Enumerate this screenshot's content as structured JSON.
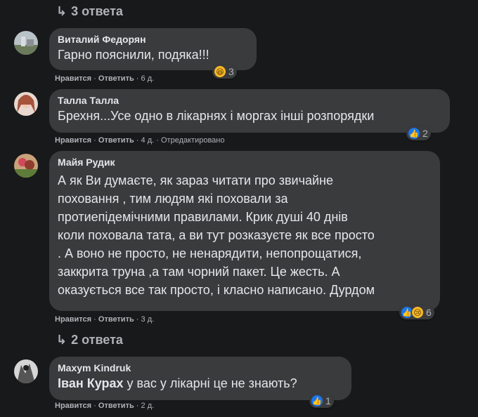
{
  "thread1_replies": {
    "label": "3 ответа"
  },
  "thread2_replies": {
    "label": "2 ответа"
  },
  "labels": {
    "like": "Нравится",
    "reply": "Ответить",
    "edited": "Отредактировано",
    "sep": "·"
  },
  "comments": [
    {
      "author": "Виталий Федорян",
      "lines": [
        "Гарно пояснили, подяка!!!"
      ],
      "time": "6 д.",
      "reaction_icons": [
        "haha-icon"
      ],
      "reaction_count": "3"
    },
    {
      "author": "Талла Талла",
      "lines": [
        "Брехня...Усе одно в лікарнях і моргах інші розпорядки"
      ],
      "time": "4 д.",
      "edited": true,
      "reaction_icons": [
        "like-icon"
      ],
      "reaction_count": "2"
    },
    {
      "author": "Майя Рудик",
      "lines": [
        "А як Ви думаєте, як зараз читати про звичайне",
        "поховання , тим людям які поховали за",
        "протиепідемічними правилами. Крик душі 40 днів",
        "коли поховала тата, а ви тут розказуєте як все просто",
        ". А воно не просто, не ненарядити, непопрощатися,",
        "заккрита труна ,а там чорний пакет. Це жесть. А",
        "оказується все так просто, і класно написано. Дурдом"
      ],
      "time": "3 д.",
      "reaction_icons": [
        "like-icon",
        "sad-icon"
      ],
      "reaction_count": "6"
    },
    {
      "author": "Maxym Kindruk",
      "mention": "Іван Курах",
      "text_after_mention": " у вас у лікарні це не знають?",
      "time": "2 д.",
      "reaction_icons": [
        "like-icon"
      ],
      "reaction_count": "1"
    }
  ]
}
